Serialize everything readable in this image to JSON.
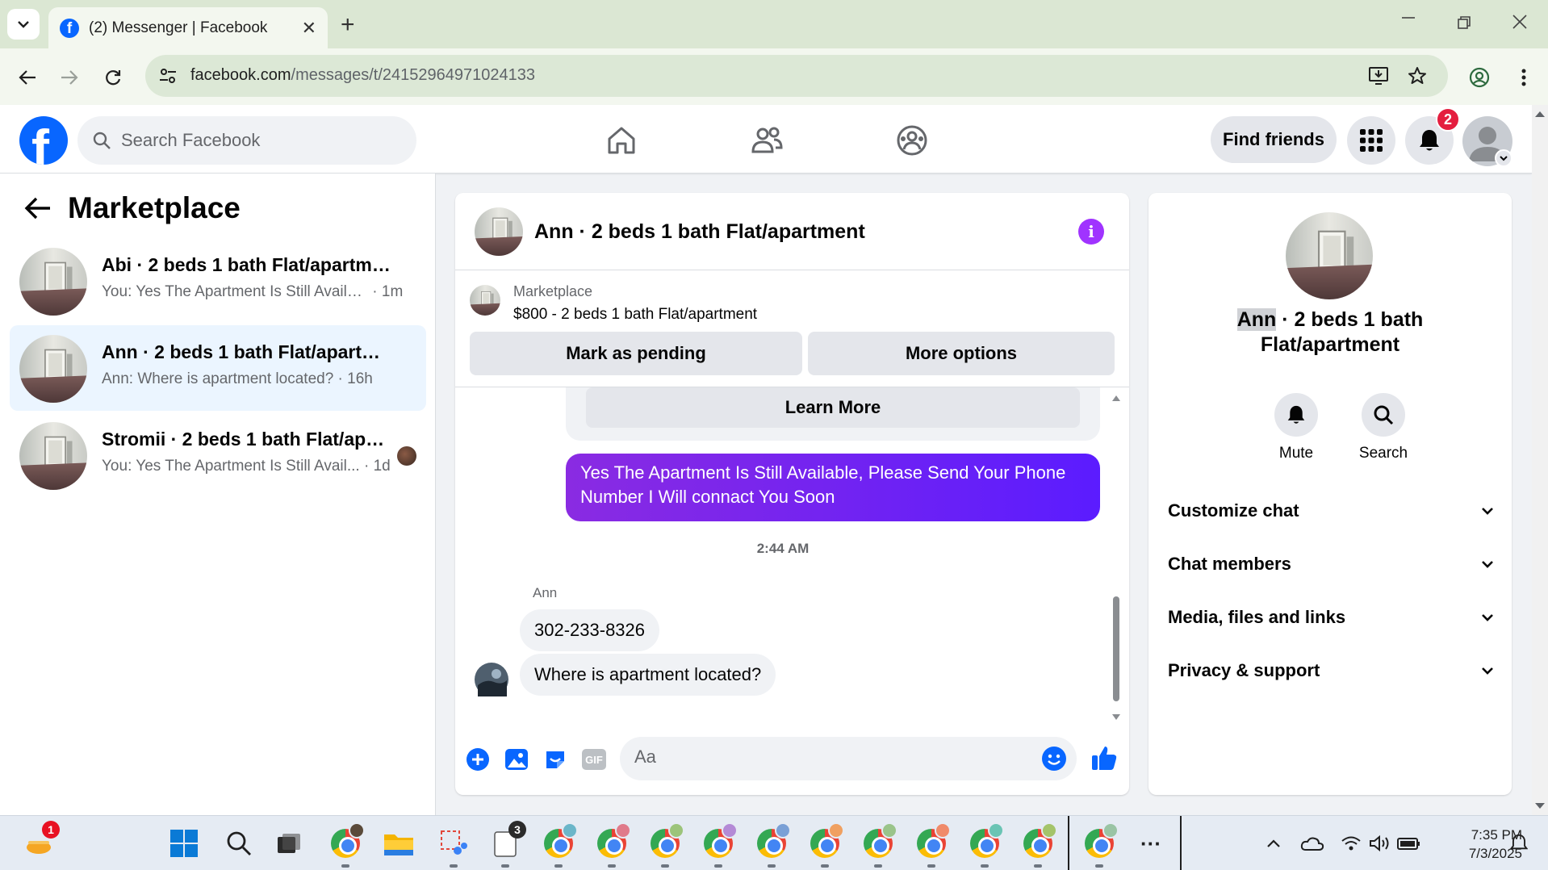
{
  "browser": {
    "tab_title": "(2) Messenger | Facebook",
    "url_host": "facebook.com",
    "url_path": "/messages/t/24152964971024133"
  },
  "header": {
    "search_placeholder": "Search Facebook",
    "find_friends_label": "Find friends",
    "notification_count": "2"
  },
  "left_panel": {
    "title": "Marketplace",
    "conversations": [
      {
        "title": "Abi · 2 beds 1 bath Flat/apartment",
        "preview": "You: Yes The Apartment Is Still Availa...",
        "time": "· 1m",
        "active": false
      },
      {
        "title": "Ann · 2 beds 1 bath Flat/apartment",
        "preview": "Ann: Where is apartment located?",
        "time": "· 16h",
        "active": true
      },
      {
        "title": "Stromii · 2 beds 1 bath Flat/apar...",
        "preview": "You: Yes The Apartment Is Still Avail...",
        "time": "· 1d",
        "active": false
      }
    ]
  },
  "chat": {
    "title": "Ann · 2 beds 1 bath Flat/apartment",
    "listing_source": "Marketplace",
    "listing_price_title": "$800 - 2 beds 1 bath Flat/apartment",
    "mark_pending_label": "Mark as pending",
    "more_options_label": "More options",
    "learn_more_label": "Learn More",
    "outgoing_message": "Yes The Apartment Is Still Available, Please Send Your Phone Number I Will connact You Soon",
    "timestamp": "2:44 AM",
    "sender_name": "Ann",
    "incoming_messages": [
      "302-233-8326",
      "Where is apartment located?"
    ],
    "composer_placeholder": "Aa",
    "gif_label": "GIF"
  },
  "right_panel": {
    "name_highlight": "Ann",
    "name_rest": " · 2 beds 1 bath Flat/apartment",
    "mute_label": "Mute",
    "search_label": "Search",
    "sections": [
      "Customize chat",
      "Chat members",
      "Media, files and links",
      "Privacy & support"
    ]
  },
  "taskbar": {
    "widgets_badge": "1",
    "notepad_badge": "3",
    "time": "7:35 PM",
    "date": "7/3/2025",
    "more_label": "···"
  },
  "colors": {
    "facebook_blue": "#0866ff",
    "messenger_purple": "#7f2bff",
    "active_conversation_bg": "#ebf5ff",
    "notification_red": "#e41e3f"
  }
}
